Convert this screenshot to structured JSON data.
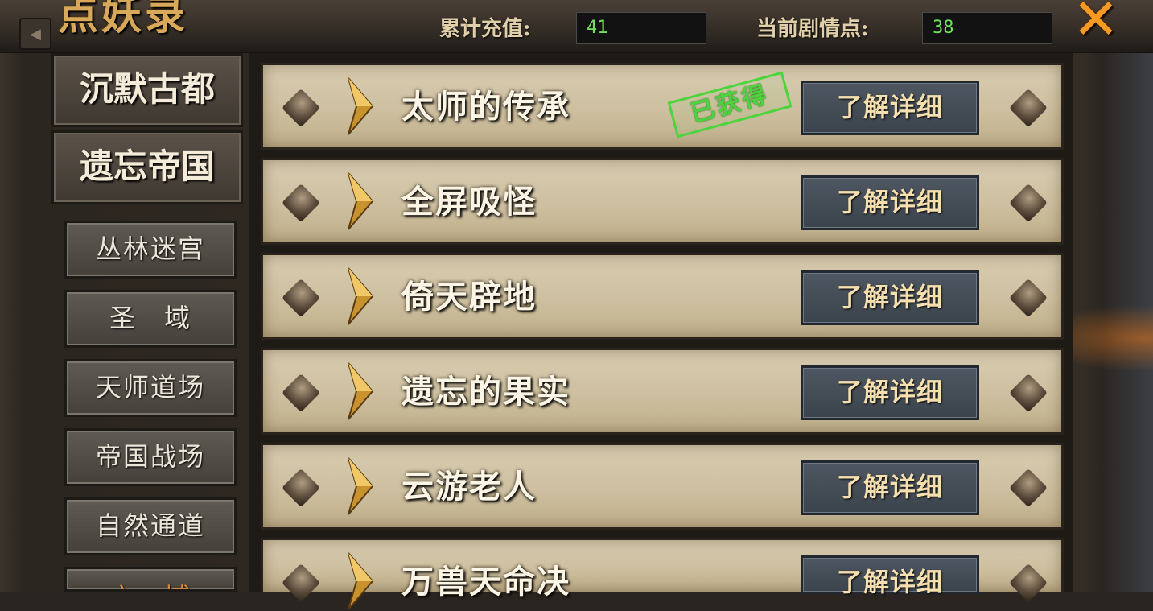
{
  "header": {
    "title": "点妖录",
    "total_recharge_label": "累计充值:",
    "total_recharge_value": "41",
    "story_points_label": "当前剧情点:",
    "story_points_value": "38",
    "close_icon": "close-x-icon",
    "prev_icon": "arrow-left-icon"
  },
  "nav": {
    "chapters": [
      {
        "label": "沉默古都"
      },
      {
        "label": "遗忘帝国"
      }
    ],
    "areas": [
      {
        "label": "丛林迷宫"
      },
      {
        "label": "圣　域"
      },
      {
        "label": "天师道场"
      },
      {
        "label": "帝国战场"
      },
      {
        "label": "自然通道"
      },
      {
        "label": "六　域"
      }
    ]
  },
  "entries": [
    {
      "name": "太师的传承",
      "button": "了解详细",
      "stamp": "已获得"
    },
    {
      "name": "全屏吸怪",
      "button": "了解详细"
    },
    {
      "name": "倚天辟地",
      "button": "了解详细"
    },
    {
      "name": "遗忘的果实",
      "button": "了解详细"
    },
    {
      "name": "云游老人",
      "button": "了解详细"
    },
    {
      "name": "万兽天命决",
      "button": "了解详细"
    }
  ],
  "colors": {
    "value_text": "#6fe05a",
    "stamp": "#4cd43c",
    "close": "#f59a22",
    "button_text": "#f6dfae"
  }
}
